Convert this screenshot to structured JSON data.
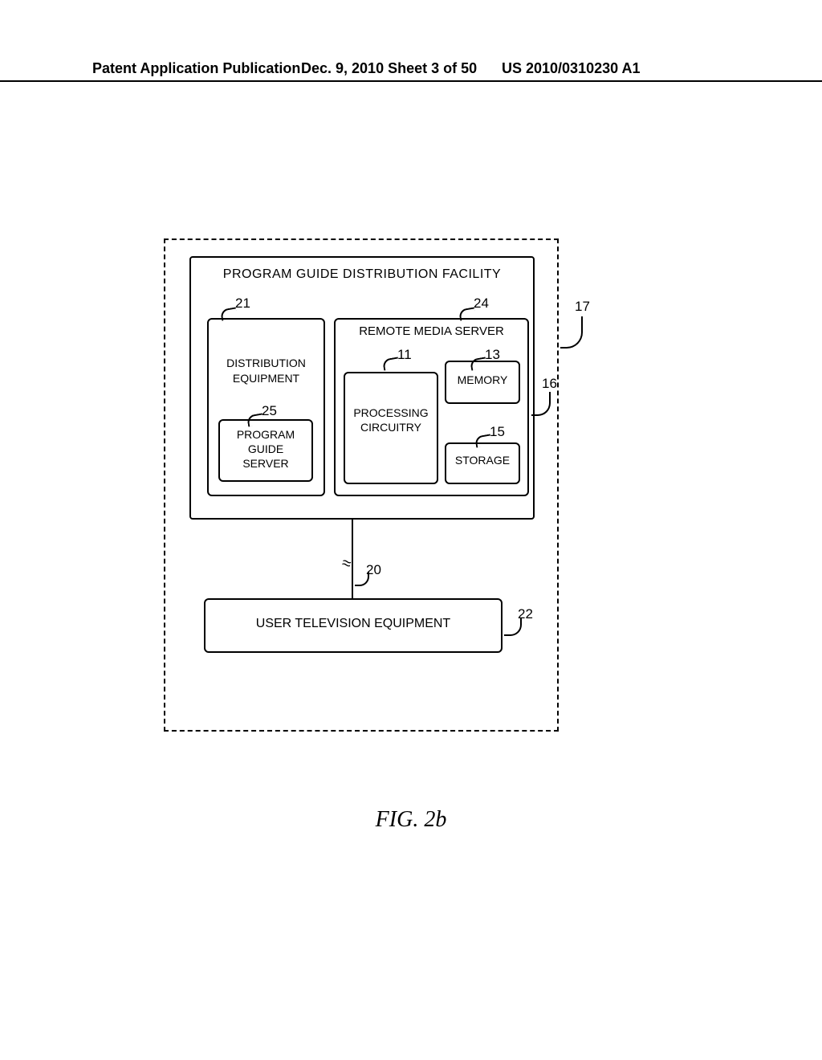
{
  "header": {
    "left": "Patent Application Publication",
    "middle": "Dec. 9, 2010   Sheet 3 of 50",
    "right": "US 2010/0310230 A1"
  },
  "facility": {
    "title": "PROGRAM GUIDE DISTRIBUTION FACILITY",
    "distribution_label": "DISTRIBUTION\nEQUIPMENT",
    "program_guide_server": "PROGRAM\nGUIDE\nSERVER",
    "remote_media_server": "REMOTE MEDIA SERVER",
    "processing_circuitry": "PROCESSING\nCIRCUITRY",
    "memory": "MEMORY",
    "storage": "STORAGE"
  },
  "user_tv": "USER TELEVISION EQUIPMENT",
  "refs": {
    "r21": "21",
    "r24": "24",
    "r11": "11",
    "r13": "13",
    "r25": "25",
    "r15": "15",
    "r16": "16",
    "r17": "17",
    "r20": "20",
    "r22": "22"
  },
  "figure_caption": "FIG. 2b"
}
